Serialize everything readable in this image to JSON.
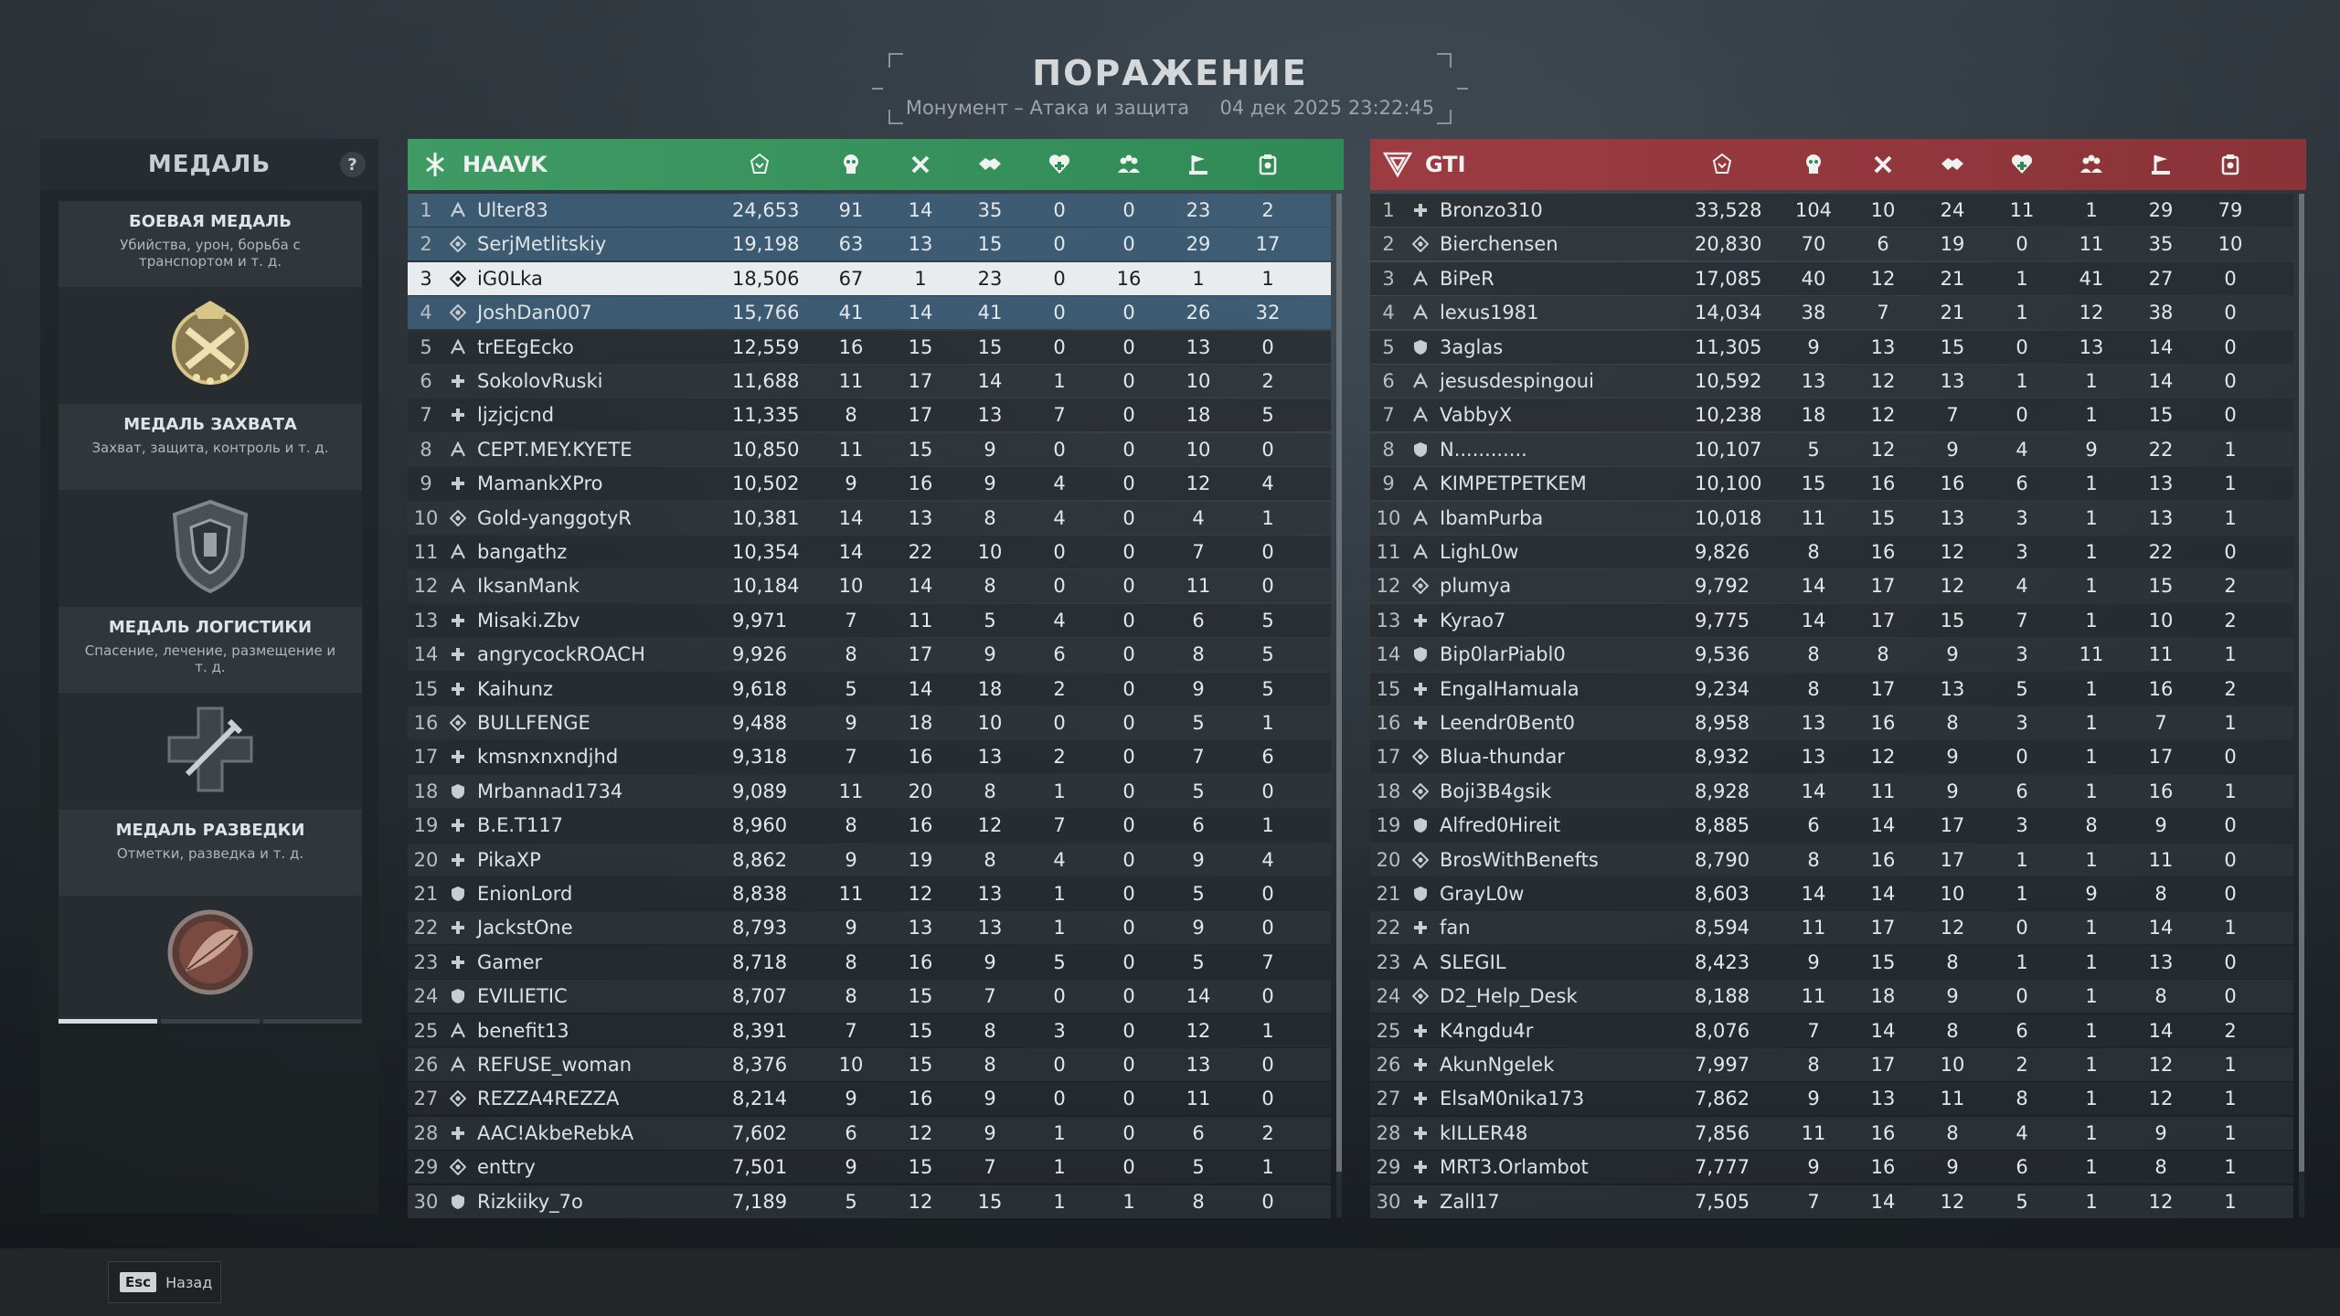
{
  "header": {
    "title": "ПОРАЖЕНИЕ",
    "subtitle": "Монумент – Атака и защита     04 дек 2025 23:22:45"
  },
  "medal_panel": {
    "title": "МЕДАЛЬ",
    "help": "?",
    "medals": [
      {
        "name": "БОЕВАЯ МЕДАЛЬ",
        "desc": "Убийства, урон, борьба с транспортом и т. д.",
        "icon": "combat-medal-icon",
        "progress": [
          1,
          1,
          1
        ]
      },
      {
        "name": "МЕДАЛЬ ЗАХВАТА",
        "desc": "Захват, защита, контроль и т. д.",
        "icon": "capture-medal-icon",
        "progress": [
          0.4,
          0,
          0
        ]
      },
      {
        "name": "МЕДАЛЬ ЛОГИСТИКИ",
        "desc": "Спасение, лечение, размещение и т. д.",
        "icon": "logistics-medal-icon",
        "progress": [
          0.1,
          0,
          0
        ]
      },
      {
        "name": "МЕДАЛЬ РАЗВЕДКИ",
        "desc": "Отметки, разведка и т. д.",
        "icon": "recon-medal-icon",
        "progress": [
          1,
          0,
          0
        ]
      }
    ]
  },
  "columns": [
    "score-icon",
    "kills-icon",
    "deaths-icon",
    "assists-icon",
    "revives-icon",
    "squad-icon",
    "objective-icon",
    "support-icon"
  ],
  "team_a": {
    "name": "HAAVK",
    "color": "#3f9a64",
    "players": [
      {
        "rank": "1",
        "cls": "assault",
        "name": "Ulter83",
        "s": [
          "24,653",
          "91",
          "14",
          "35",
          "0",
          "0",
          "23",
          "2"
        ],
        "hl": true
      },
      {
        "rank": "2",
        "cls": "recon",
        "name": "SerjMetlitskiy",
        "s": [
          "19,198",
          "63",
          "13",
          "15",
          "0",
          "0",
          "29",
          "17"
        ],
        "hl": true
      },
      {
        "rank": "3",
        "cls": "recon",
        "name": "iG0Lka",
        "s": [
          "18,506",
          "67",
          "1",
          "23",
          "0",
          "16",
          "1",
          "1"
        ],
        "me": true
      },
      {
        "rank": "4",
        "cls": "recon",
        "name": "JoshDan007",
        "s": [
          "15,766",
          "41",
          "14",
          "41",
          "0",
          "0",
          "26",
          "32"
        ],
        "hl": true
      },
      {
        "rank": "5",
        "cls": "assault",
        "name": "trEEgEcko",
        "s": [
          "12,559",
          "16",
          "15",
          "15",
          "0",
          "0",
          "13",
          "0"
        ]
      },
      {
        "rank": "6",
        "cls": "medic",
        "name": "SokolovRuski",
        "s": [
          "11,688",
          "11",
          "17",
          "14",
          "1",
          "0",
          "10",
          "2"
        ]
      },
      {
        "rank": "7",
        "cls": "medic",
        "name": "ljzjcjcnd",
        "s": [
          "11,335",
          "8",
          "17",
          "13",
          "7",
          "0",
          "18",
          "5"
        ]
      },
      {
        "rank": "8",
        "cls": "assault",
        "name": "CEPT.MEY.KYETE",
        "s": [
          "10,850",
          "11",
          "15",
          "9",
          "0",
          "0",
          "10",
          "0"
        ]
      },
      {
        "rank": "9",
        "cls": "medic",
        "name": "MamankXPro",
        "s": [
          "10,502",
          "9",
          "16",
          "9",
          "4",
          "0",
          "12",
          "4"
        ]
      },
      {
        "rank": "10",
        "cls": "recon",
        "name": "Gold-yanggotyR",
        "s": [
          "10,381",
          "14",
          "13",
          "8",
          "4",
          "0",
          "4",
          "1"
        ]
      },
      {
        "rank": "11",
        "cls": "assault",
        "name": "bangathz",
        "s": [
          "10,354",
          "14",
          "22",
          "10",
          "0",
          "0",
          "7",
          "0"
        ]
      },
      {
        "rank": "12",
        "cls": "assault",
        "name": "IksanMank",
        "s": [
          "10,184",
          "10",
          "14",
          "8",
          "0",
          "0",
          "11",
          "0"
        ]
      },
      {
        "rank": "13",
        "cls": "medic",
        "name": "Misaki.Zbv",
        "s": [
          "9,971",
          "7",
          "11",
          "5",
          "4",
          "0",
          "6",
          "5"
        ]
      },
      {
        "rank": "14",
        "cls": "medic",
        "name": "angrycockROACH",
        "s": [
          "9,926",
          "8",
          "17",
          "9",
          "6",
          "0",
          "8",
          "5"
        ]
      },
      {
        "rank": "15",
        "cls": "medic",
        "name": "Kaihunz",
        "s": [
          "9,618",
          "5",
          "14",
          "18",
          "2",
          "0",
          "9",
          "5"
        ]
      },
      {
        "rank": "16",
        "cls": "recon",
        "name": "BULLFENGE",
        "s": [
          "9,488",
          "9",
          "18",
          "10",
          "0",
          "0",
          "5",
          "1"
        ]
      },
      {
        "rank": "17",
        "cls": "medic",
        "name": "kmsnxnxndjhd",
        "s": [
          "9,318",
          "7",
          "16",
          "13",
          "2",
          "0",
          "7",
          "6"
        ]
      },
      {
        "rank": "18",
        "cls": "support",
        "name": "Mrbannad1734",
        "s": [
          "9,089",
          "11",
          "20",
          "8",
          "1",
          "0",
          "5",
          "0"
        ]
      },
      {
        "rank": "19",
        "cls": "medic",
        "name": "B.E.T117",
        "s": [
          "8,960",
          "8",
          "16",
          "12",
          "7",
          "0",
          "6",
          "1"
        ]
      },
      {
        "rank": "20",
        "cls": "medic",
        "name": "PikaXP",
        "s": [
          "8,862",
          "9",
          "19",
          "8",
          "4",
          "0",
          "9",
          "4"
        ]
      },
      {
        "rank": "21",
        "cls": "support",
        "name": "EnionLord",
        "s": [
          "8,838",
          "11",
          "12",
          "13",
          "1",
          "0",
          "5",
          "0"
        ]
      },
      {
        "rank": "22",
        "cls": "medic",
        "name": "JackstOne",
        "s": [
          "8,793",
          "9",
          "13",
          "13",
          "1",
          "0",
          "9",
          "0"
        ]
      },
      {
        "rank": "23",
        "cls": "medic",
        "name": "Gamer",
        "s": [
          "8,718",
          "8",
          "16",
          "9",
          "5",
          "0",
          "5",
          "7"
        ]
      },
      {
        "rank": "24",
        "cls": "support",
        "name": "EVILIETIC",
        "s": [
          "8,707",
          "8",
          "15",
          "7",
          "0",
          "0",
          "14",
          "0"
        ]
      },
      {
        "rank": "25",
        "cls": "assault",
        "name": "benefit13",
        "s": [
          "8,391",
          "7",
          "15",
          "8",
          "3",
          "0",
          "12",
          "1"
        ]
      },
      {
        "rank": "26",
        "cls": "assault",
        "name": "REFUSE_woman",
        "s": [
          "8,376",
          "10",
          "15",
          "8",
          "0",
          "0",
          "13",
          "0"
        ]
      },
      {
        "rank": "27",
        "cls": "recon",
        "name": "REZZA4REZZA",
        "s": [
          "8,214",
          "9",
          "16",
          "9",
          "0",
          "0",
          "11",
          "0"
        ]
      },
      {
        "rank": "28",
        "cls": "medic",
        "name": "AAC!AkbeRebkA",
        "s": [
          "7,602",
          "6",
          "12",
          "9",
          "1",
          "0",
          "6",
          "2"
        ]
      },
      {
        "rank": "29",
        "cls": "recon",
        "name": "enttry",
        "s": [
          "7,501",
          "9",
          "15",
          "7",
          "1",
          "0",
          "5",
          "1"
        ]
      },
      {
        "rank": "30",
        "cls": "support",
        "name": "Rizkiiky_7o",
        "s": [
          "7,189",
          "5",
          "12",
          "15",
          "1",
          "1",
          "8",
          "0"
        ]
      }
    ]
  },
  "team_b": {
    "name": "GTI",
    "color": "#9c3c42",
    "players": [
      {
        "rank": "1",
        "cls": "medic",
        "name": "Bronzo310",
        "s": [
          "33,528",
          "104",
          "10",
          "24",
          "11",
          "1",
          "29",
          "79"
        ]
      },
      {
        "rank": "2",
        "cls": "recon",
        "name": "Bierchensen",
        "s": [
          "20,830",
          "70",
          "6",
          "19",
          "0",
          "11",
          "35",
          "10"
        ]
      },
      {
        "rank": "3",
        "cls": "assault",
        "name": "BiPeR",
        "s": [
          "17,085",
          "40",
          "12",
          "21",
          "1",
          "41",
          "27",
          "0"
        ]
      },
      {
        "rank": "4",
        "cls": "assault",
        "name": "lexus1981",
        "s": [
          "14,034",
          "38",
          "7",
          "21",
          "1",
          "12",
          "38",
          "0"
        ]
      },
      {
        "rank": "5",
        "cls": "support",
        "name": "3aglas",
        "s": [
          "11,305",
          "9",
          "13",
          "15",
          "0",
          "13",
          "14",
          "0"
        ]
      },
      {
        "rank": "6",
        "cls": "assault",
        "name": "jesusdespingoui",
        "s": [
          "10,592",
          "13",
          "12",
          "13",
          "1",
          "1",
          "14",
          "0"
        ]
      },
      {
        "rank": "7",
        "cls": "assault",
        "name": "VabbyX",
        "s": [
          "10,238",
          "18",
          "12",
          "7",
          "0",
          "1",
          "15",
          "0"
        ]
      },
      {
        "rank": "8",
        "cls": "support",
        "name": "N............",
        "s": [
          "10,107",
          "5",
          "12",
          "9",
          "4",
          "9",
          "22",
          "1"
        ]
      },
      {
        "rank": "9",
        "cls": "assault",
        "name": "KIMPETPETKEM",
        "s": [
          "10,100",
          "15",
          "16",
          "16",
          "6",
          "1",
          "13",
          "1"
        ]
      },
      {
        "rank": "10",
        "cls": "assault",
        "name": "IbamPurba",
        "s": [
          "10,018",
          "11",
          "15",
          "13",
          "3",
          "1",
          "13",
          "1"
        ]
      },
      {
        "rank": "11",
        "cls": "assault",
        "name": "LighL0w",
        "s": [
          "9,826",
          "8",
          "16",
          "12",
          "3",
          "1",
          "22",
          "0"
        ]
      },
      {
        "rank": "12",
        "cls": "recon",
        "name": "plumya",
        "s": [
          "9,792",
          "14",
          "17",
          "12",
          "4",
          "1",
          "15",
          "2"
        ]
      },
      {
        "rank": "13",
        "cls": "medic",
        "name": "Kyrao7",
        "s": [
          "9,775",
          "14",
          "17",
          "15",
          "7",
          "1",
          "10",
          "2"
        ]
      },
      {
        "rank": "14",
        "cls": "support",
        "name": "Bip0larPiabl0",
        "s": [
          "9,536",
          "8",
          "8",
          "9",
          "3",
          "11",
          "11",
          "1"
        ]
      },
      {
        "rank": "15",
        "cls": "medic",
        "name": "EngalHamuala",
        "s": [
          "9,234",
          "8",
          "17",
          "13",
          "5",
          "1",
          "16",
          "2"
        ]
      },
      {
        "rank": "16",
        "cls": "medic",
        "name": "Leendr0Bent0",
        "s": [
          "8,958",
          "13",
          "16",
          "8",
          "3",
          "1",
          "7",
          "1"
        ]
      },
      {
        "rank": "17",
        "cls": "recon",
        "name": "Blua-thundar",
        "s": [
          "8,932",
          "13",
          "12",
          "9",
          "0",
          "1",
          "17",
          "0"
        ]
      },
      {
        "rank": "18",
        "cls": "recon",
        "name": "Boji3B4gsik",
        "s": [
          "8,928",
          "14",
          "11",
          "9",
          "6",
          "1",
          "16",
          "1"
        ]
      },
      {
        "rank": "19",
        "cls": "support",
        "name": "Alfred0Hireit",
        "s": [
          "8,885",
          "6",
          "14",
          "17",
          "3",
          "8",
          "9",
          "0"
        ]
      },
      {
        "rank": "20",
        "cls": "recon",
        "name": "BrosWithBenefts",
        "s": [
          "8,790",
          "8",
          "16",
          "17",
          "1",
          "1",
          "11",
          "0"
        ]
      },
      {
        "rank": "21",
        "cls": "support",
        "name": "GrayL0w",
        "s": [
          "8,603",
          "14",
          "14",
          "10",
          "1",
          "9",
          "8",
          "0"
        ]
      },
      {
        "rank": "22",
        "cls": "medic",
        "name": "fan",
        "s": [
          "8,594",
          "11",
          "17",
          "12",
          "0",
          "1",
          "14",
          "1"
        ]
      },
      {
        "rank": "23",
        "cls": "assault",
        "name": "SLEGIL",
        "s": [
          "8,423",
          "9",
          "15",
          "8",
          "1",
          "1",
          "13",
          "0"
        ]
      },
      {
        "rank": "24",
        "cls": "recon",
        "name": "D2_Help_Desk",
        "s": [
          "8,188",
          "11",
          "18",
          "9",
          "0",
          "1",
          "8",
          "0"
        ]
      },
      {
        "rank": "25",
        "cls": "medic",
        "name": "K4ngdu4r",
        "s": [
          "8,076",
          "7",
          "14",
          "8",
          "6",
          "1",
          "14",
          "2"
        ]
      },
      {
        "rank": "26",
        "cls": "medic",
        "name": "AkunNgelek",
        "s": [
          "7,997",
          "8",
          "17",
          "10",
          "2",
          "1",
          "12",
          "1"
        ]
      },
      {
        "rank": "27",
        "cls": "medic",
        "name": "ElsaM0nika173",
        "s": [
          "7,862",
          "9",
          "13",
          "11",
          "8",
          "1",
          "12",
          "1"
        ]
      },
      {
        "rank": "28",
        "cls": "medic",
        "name": "kILLER48",
        "s": [
          "7,856",
          "11",
          "16",
          "8",
          "4",
          "1",
          "9",
          "1"
        ]
      },
      {
        "rank": "29",
        "cls": "medic",
        "name": "MRT3.Orlambot",
        "s": [
          "7,777",
          "9",
          "16",
          "9",
          "6",
          "1",
          "8",
          "1"
        ]
      },
      {
        "rank": "30",
        "cls": "medic",
        "name": "Zall17",
        "s": [
          "7,505",
          "7",
          "14",
          "12",
          "5",
          "1",
          "12",
          "1"
        ]
      }
    ]
  },
  "footer": {
    "esc_key": "Esc",
    "back_label": "Назад"
  }
}
